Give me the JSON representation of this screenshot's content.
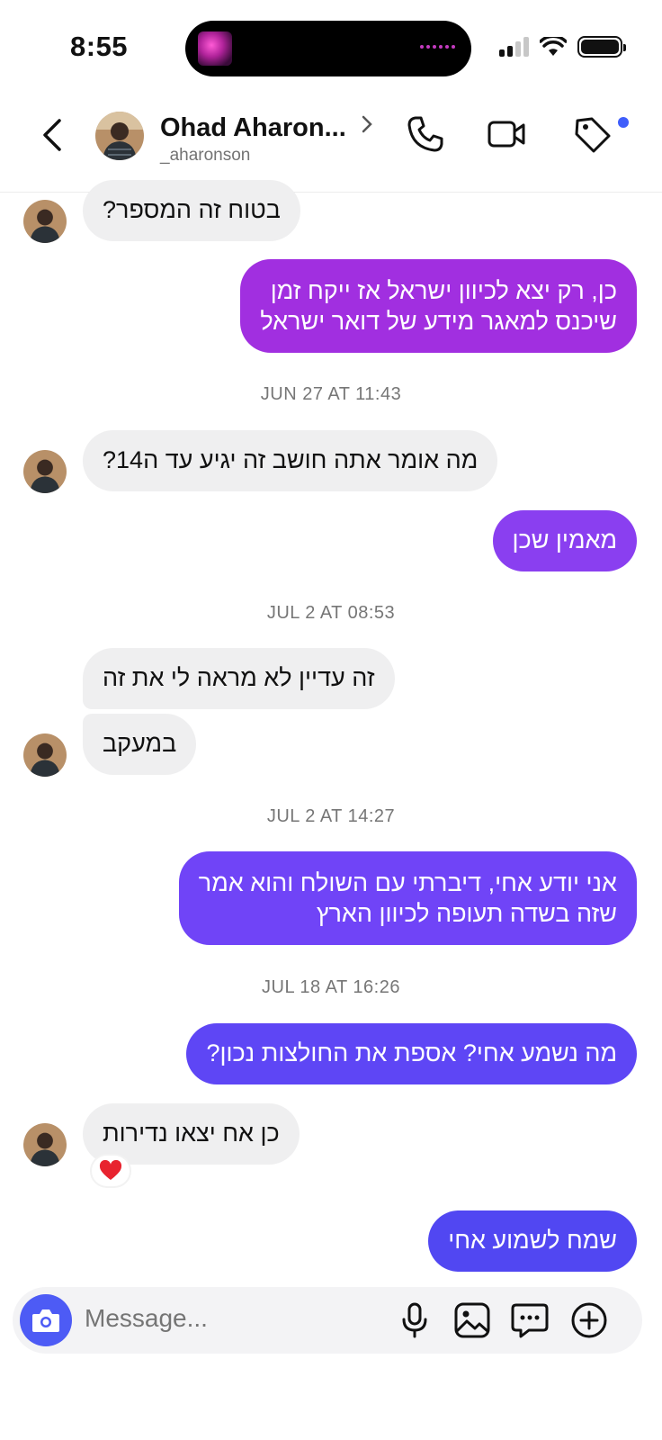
{
  "status_bar": {
    "time": "8:55"
  },
  "header": {
    "name": "Ohad Aharon...",
    "username": "_aharonson"
  },
  "messages": [
    {
      "text": "בטוח זה המספר?"
    },
    {
      "line1": "כן, רק יצא לכיוון ישראל אז ייקח זמן",
      "line2": "שיכנס למאגר מידע של דואר ישראל"
    },
    {
      "stamp": "JUN 27 AT 11:43"
    },
    {
      "text": "מה אומר אתה חושב זה יגיע עד ה14?"
    },
    {
      "text": "מאמין שכן"
    },
    {
      "stamp": "JUL 2 AT 08:53"
    },
    {
      "text": "זה עדיין לא מראה לי את זה"
    },
    {
      "text": "במעקב"
    },
    {
      "stamp": "JUL 2 AT 14:27"
    },
    {
      "line1": "אני יודע אחי, דיברתי עם השולח והוא אמר",
      "line2": "שזה בשדה תעופה לכיוון הארץ"
    },
    {
      "stamp": "JUL 18 AT 16:26"
    },
    {
      "text": "מה נשמע אחי? אספת את החולצות נכון?"
    },
    {
      "text": "כן אח יצאו נדירות",
      "reaction": "❤️"
    },
    {
      "text": "שמח לשמוע אחי"
    }
  ],
  "composer": {
    "placeholder": "Message..."
  },
  "colors": {
    "outgoing_1": "#a12fe0",
    "outgoing_2": "#8a3ff0",
    "outgoing_3": "#7044f7",
    "outgoing_4": "#5e46f5",
    "outgoing_5": "#5147f2",
    "incoming": "#efeff0",
    "accent": "#3f5efb"
  },
  "icons": [
    "chevron-left-icon",
    "chevron-right-icon",
    "phone-icon",
    "video-icon",
    "tag-icon",
    "camera-icon",
    "microphone-icon",
    "image-icon",
    "sticker-icon",
    "plus-icon",
    "heart-icon"
  ]
}
